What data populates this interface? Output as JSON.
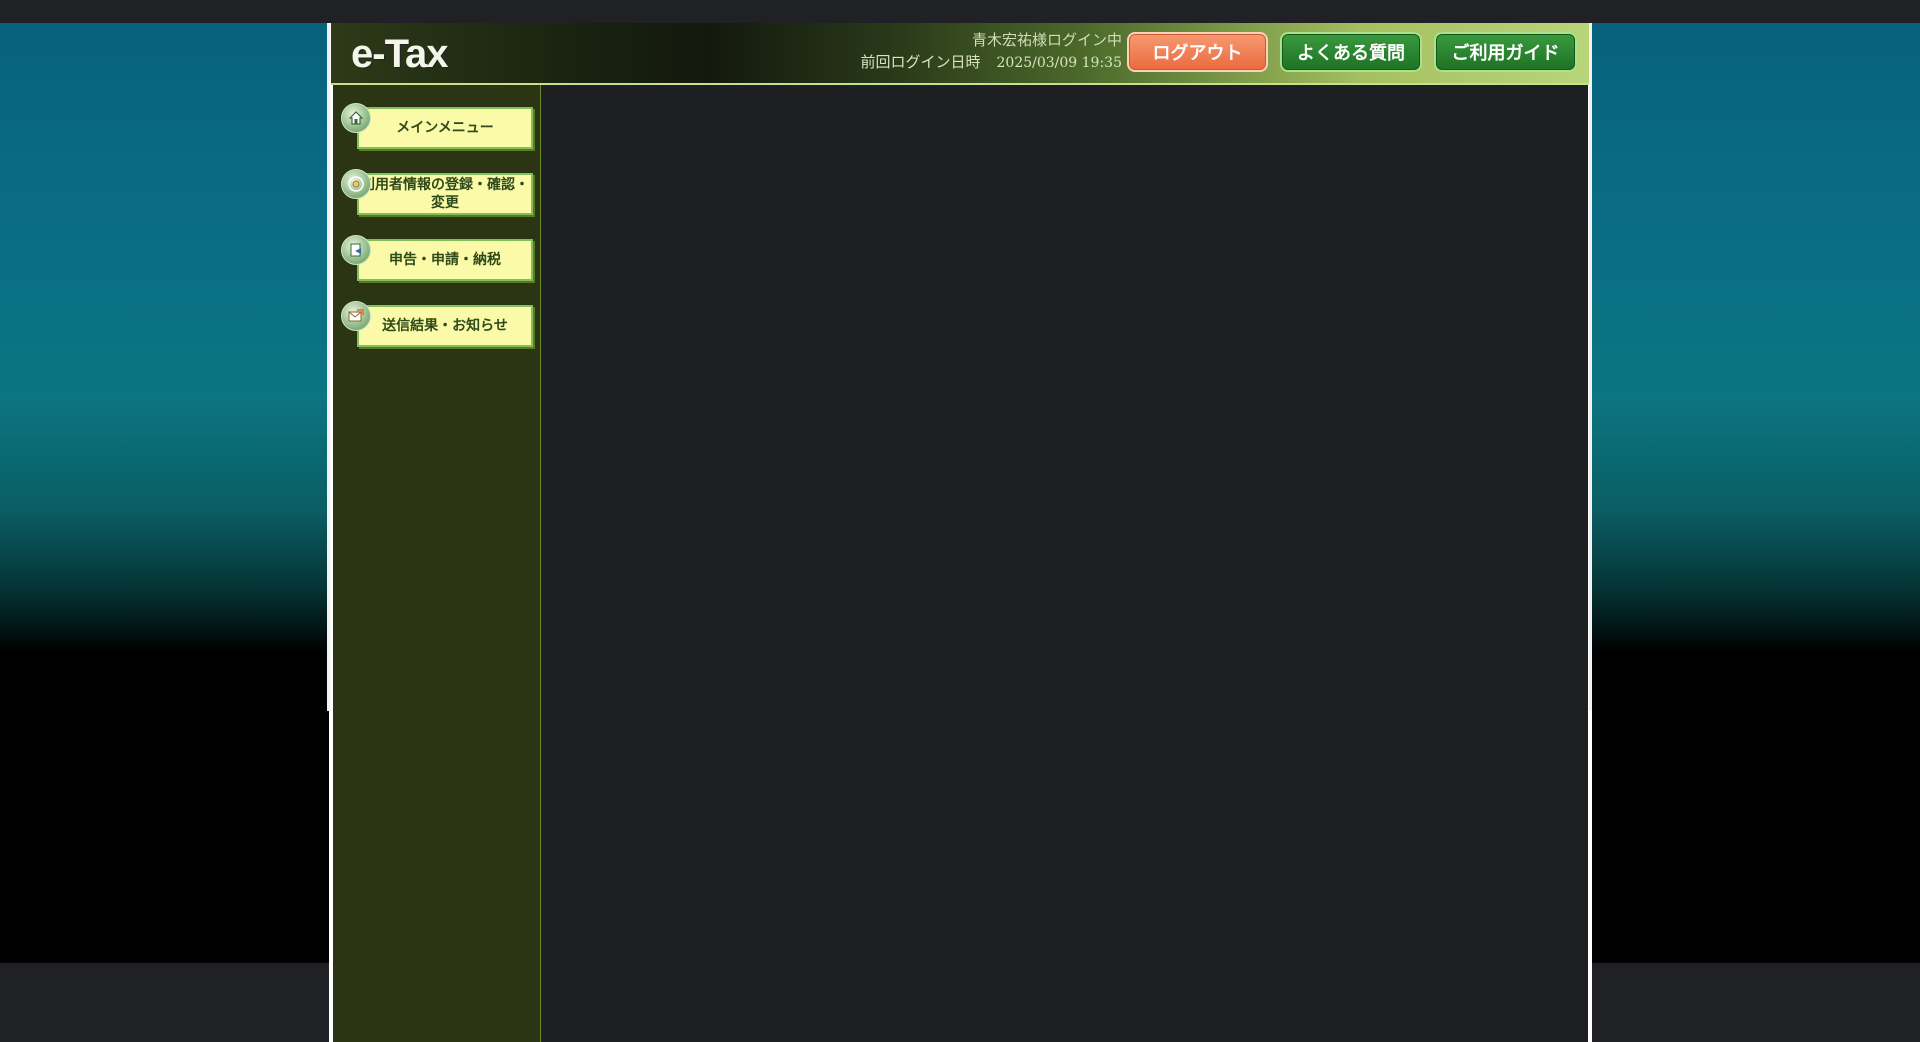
{
  "app": {
    "logo_text": "e-Tax"
  },
  "header": {
    "login_user": "青木宏祐様ログイン中",
    "last_login_label": "前回ログイン日時",
    "last_login_time": "2025/03/09 19:35",
    "buttons": {
      "logout": "ログアウト",
      "faq": "よくある質問",
      "guide": "ご利用ガイド"
    }
  },
  "sidebar": {
    "items": [
      {
        "label": "メインメニュー",
        "icon": "home-icon"
      },
      {
        "label": "利用者情報の登録・確認・変更",
        "icon": "user-info-icon"
      },
      {
        "label": "申告・申請・納税",
        "icon": "declaration-icon"
      },
      {
        "label": "送信結果・お知らせ",
        "icon": "mail-icon"
      }
    ]
  },
  "colors": {
    "logout_accent": "#ea6a3e",
    "nav_button_bg": "#fafaa8",
    "header_green": "#1e7224",
    "sidebar_bg": "#2b3514"
  }
}
